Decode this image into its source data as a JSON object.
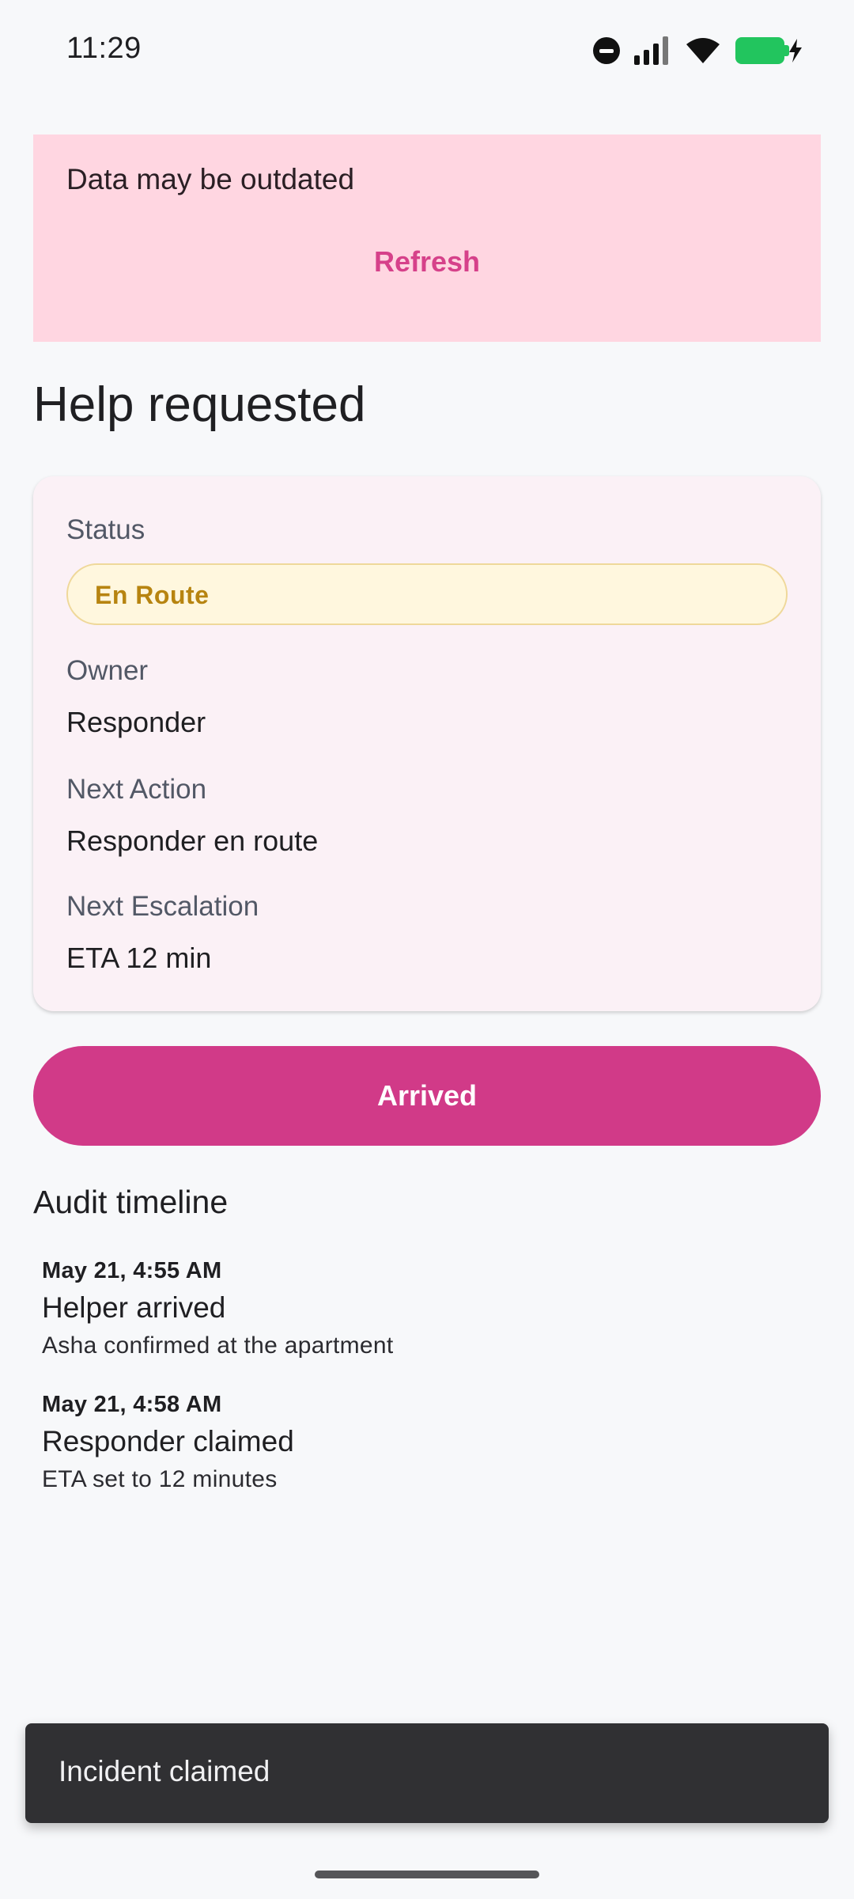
{
  "status_bar": {
    "time": "11:29",
    "icons": [
      "do-not-disturb-icon",
      "signal-icon",
      "wifi-icon",
      "battery-charging-icon"
    ],
    "battery_color": "#22c55e"
  },
  "banner": {
    "message": "Data may be outdated",
    "action_label": "Refresh",
    "background_color": "#ffd6e1",
    "action_color": "#d6418a"
  },
  "page": {
    "title": "Help requested"
  },
  "status_card": {
    "status_label": "Status",
    "status_value": "En Route",
    "owner_label": "Owner",
    "owner_value": "Responder",
    "next_action_label": "Next Action",
    "next_action_value": "Responder en route",
    "next_escalation_label": "Next Escalation",
    "next_escalation_value": "ETA 12 min",
    "status_pill_color": "#fff7de",
    "status_text_color": "#b78410"
  },
  "primary_action": {
    "label": "Arrived",
    "color": "#d13a88"
  },
  "timeline": {
    "title": "Audit timeline",
    "entries": [
      {
        "time": "May 21, 4:55 AM",
        "title": "Helper arrived",
        "detail": "Asha confirmed at the apartment"
      },
      {
        "time": "May 21, 4:58 AM",
        "title": "Responder claimed",
        "detail": "ETA set to 12 minutes"
      }
    ]
  },
  "snackbar": {
    "message": "Incident claimed"
  }
}
